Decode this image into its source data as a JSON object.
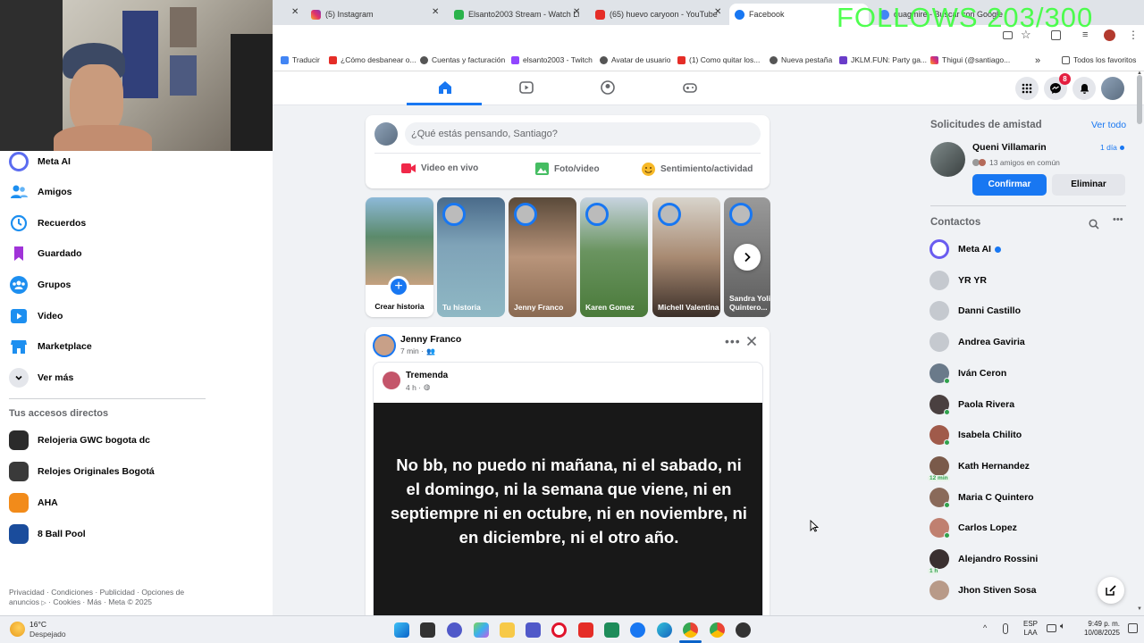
{
  "overlay": {
    "follows": "FOLLOWS 203/300"
  },
  "browser": {
    "tabs": [
      {
        "label": "(5) Instagram"
      },
      {
        "label": "Elsanto2003 Stream - Watch Li"
      },
      {
        "label": "(65) huevo caryoon - YouTube"
      },
      {
        "label": "Facebook"
      },
      {
        "label": "quagmire - Buscar con Google"
      }
    ],
    "bookmarks": [
      "Traducir",
      "¿Cómo desbanear o...",
      "Cuentas y facturación",
      "elsanto2003 - Twitch",
      "Avatar de usuario",
      "(1) Como quitar los...",
      "Nueva pestaña",
      "JKLM.FUN: Party ga...",
      "Thigui (@santiago..."
    ],
    "all_bookmarks": "Todos los favoritos"
  },
  "fb": {
    "messenger_badge": "8",
    "left_nav": [
      "Meta AI",
      "Amigos",
      "Recuerdos",
      "Guardado",
      "Grupos",
      "Video",
      "Marketplace",
      "Ver más"
    ],
    "shortcuts_title": "Tus accesos directos",
    "shortcuts": [
      "Relojeria GWC bogota dc",
      "Relojes Originales Bogotá",
      "AHA",
      "8 Ball Pool"
    ],
    "footer_1": "Privacidad · Condiciones · Publicidad · Opciones de",
    "footer_2": "anuncios",
    "footer_3": "· Cookies · Más · Meta © 2025",
    "composer": {
      "placeholder": "¿Qué estás pensando, Santiago?",
      "live": "Video en vivo",
      "photo": "Foto/video",
      "feeling": "Sentimiento/actividad"
    },
    "stories": [
      "Crear historia",
      "Tu historia",
      "Jenny Franco",
      "Karen Gomez",
      "Michell Valentina",
      "Sandra Yoli Quintero..."
    ],
    "post": {
      "author": "Jenny Franco",
      "time": "7 min ·",
      "shared_author": "Tremenda",
      "shared_time": "4 h ·",
      "text": "No bb, no puedo ni mañana, ni el sabado, ni el domingo, ni la semana que viene, ni en septiempre ni en octubre, ni en noviembre, ni en diciembre, ni el otro año."
    },
    "friend_requests": {
      "title": "Solicitudes de amistad",
      "see_all": "Ver todo",
      "name": "Queni Villamarin",
      "age": "1 día",
      "mutual": "13 amigos en común",
      "confirm": "Confirmar",
      "delete": "Eliminar"
    },
    "contacts_title": "Contactos",
    "contacts": [
      {
        "name": "Meta AI",
        "online": false,
        "badge": ""
      },
      {
        "name": "YR YR",
        "online": false,
        "badge": ""
      },
      {
        "name": "Danni Castillo",
        "online": false,
        "badge": ""
      },
      {
        "name": "Andrea Gaviria",
        "online": false,
        "badge": ""
      },
      {
        "name": "Iván Ceron",
        "online": true,
        "badge": ""
      },
      {
        "name": "Paola Rivera",
        "online": true,
        "badge": ""
      },
      {
        "name": "Isabela Chilito",
        "online": true,
        "badge": ""
      },
      {
        "name": "Kath Hernandez",
        "online": false,
        "badge": "12 min"
      },
      {
        "name": "Maria C Quintero",
        "online": true,
        "badge": ""
      },
      {
        "name": "Carlos Lopez",
        "online": true,
        "badge": ""
      },
      {
        "name": "Alejandro Rossini",
        "online": false,
        "badge": "1 h"
      },
      {
        "name": "Jhon Stiven Sosa",
        "online": false,
        "badge": ""
      }
    ]
  },
  "taskbar": {
    "weather_temp": "16°C",
    "weather_desc": "Despejado",
    "lang": "ESP",
    "lang2": "LAA",
    "time": "9:49 p. m.",
    "date": "10/08/2025"
  }
}
